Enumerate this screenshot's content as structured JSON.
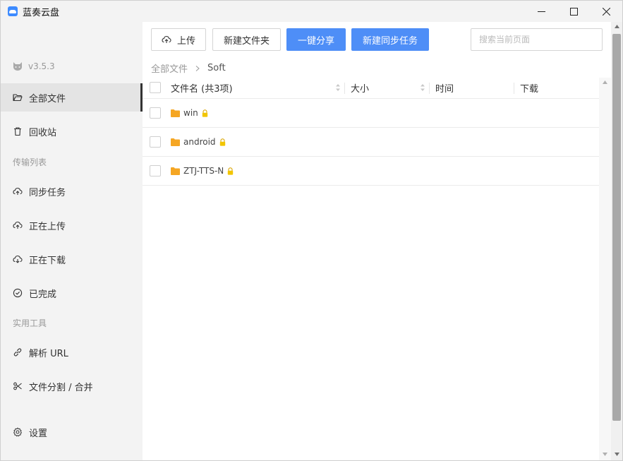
{
  "window": {
    "title": "蓝奏云盘"
  },
  "sidebar": {
    "version": "v3.5.3",
    "items": [
      {
        "label": "全部文件",
        "icon": "folder-open-icon",
        "active": true
      },
      {
        "label": "回收站",
        "icon": "trash-icon"
      },
      {
        "label": "同步任务",
        "icon": "cloud-sync-icon"
      },
      {
        "label": "正在上传",
        "icon": "cloud-upload-icon"
      },
      {
        "label": "正在下载",
        "icon": "cloud-download-icon"
      },
      {
        "label": "已完成",
        "icon": "check-circle-icon"
      },
      {
        "label": "解析 URL",
        "icon": "link-icon"
      },
      {
        "label": "文件分割 / 合并",
        "icon": "scissors-icon"
      },
      {
        "label": "设置",
        "icon": "gear-icon"
      }
    ],
    "sections": {
      "transfer": "传输列表",
      "tools": "实用工具"
    }
  },
  "toolbar": {
    "upload": "上传",
    "new_folder": "新建文件夹",
    "share": "一键分享",
    "new_sync": "新建同步任务",
    "search_placeholder": "搜索当前页面"
  },
  "breadcrumb": {
    "root": "全部文件",
    "current": "Soft"
  },
  "table": {
    "headers": {
      "name": "文件名 (共3项)",
      "size": "大小",
      "time": "时间",
      "download": "下载"
    },
    "rows": [
      {
        "name": "win",
        "locked": true
      },
      {
        "name": "android",
        "locked": true
      },
      {
        "name": "ZTJ-TTS-N",
        "locked": true
      }
    ]
  },
  "colors": {
    "primary": "#4e8ef7",
    "folder": "#f5a623",
    "lock": "#f2c500",
    "sidebar_bg": "#f3f3f3"
  }
}
